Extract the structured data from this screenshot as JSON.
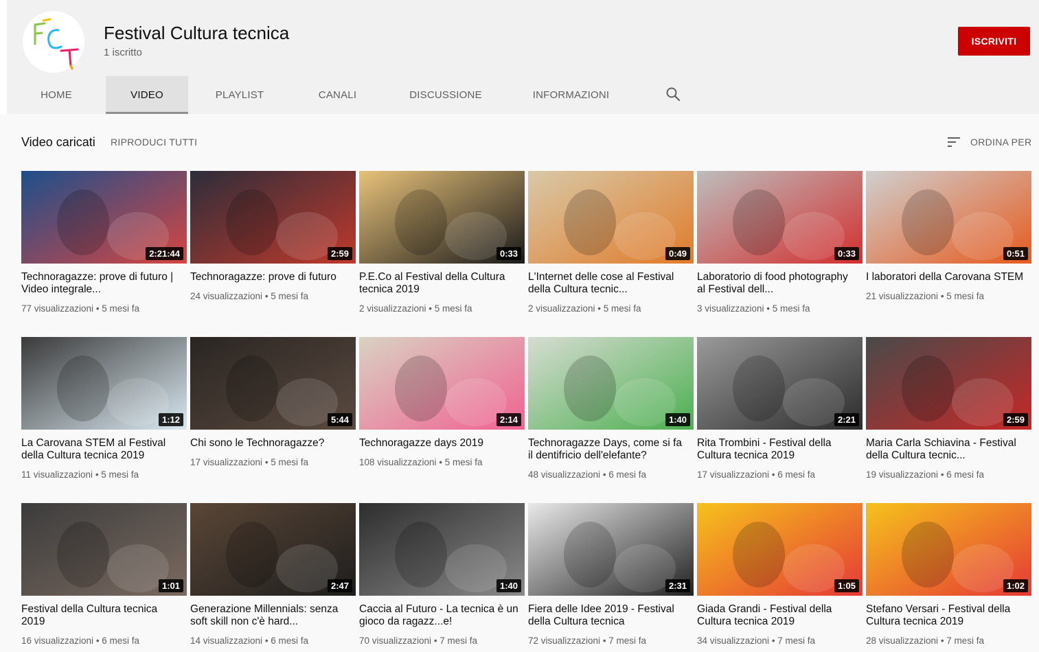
{
  "channel": {
    "name": "Festival Cultura tecnica",
    "subscribers": "1 iscritto",
    "subscribe_label": "ISCRIVITI",
    "logo_letters": "FCT"
  },
  "tabs": [
    {
      "label": "HOME",
      "active": false
    },
    {
      "label": "VIDEO",
      "active": true
    },
    {
      "label": "PLAYLIST",
      "active": false
    },
    {
      "label": "CANALI",
      "active": false
    },
    {
      "label": "DISCUSSIONE",
      "active": false
    },
    {
      "label": "INFORMAZIONI",
      "active": false
    }
  ],
  "section": {
    "title": "Video caricati",
    "play_all": "RIPRODUCI TUTTI",
    "sort_label": "ORDINA PER"
  },
  "colors": {
    "accent": "#cc0000",
    "header_bg": "#f1f1f1",
    "page_bg": "#f9f9f9",
    "text_secondary": "#606060"
  },
  "videos": [
    {
      "title": "Technoragazze: prove di futuro | Video integrale...",
      "views": "77 visualizzazioni",
      "age": "5 mesi fa",
      "duration": "2:21:44",
      "c1": "#1d4f8c",
      "c2": "#d64541"
    },
    {
      "title": "Technoragazze: prove di futuro",
      "views": "24 visualizzazioni",
      "age": "5 mesi fa",
      "duration": "2:59",
      "c1": "#2d2d3a",
      "c2": "#c0392b"
    },
    {
      "title": "P.E.Co al Festival della Cultura tecnica 2019",
      "views": "2 visualizzazioni",
      "age": "5 mesi fa",
      "duration": "0:33",
      "c1": "#e8c27a",
      "c2": "#1a1a1a"
    },
    {
      "title": "L'Internet delle cose al Festival della Cultura tecnic...",
      "views": "2 visualizzazioni",
      "age": "5 mesi fa",
      "duration": "0:49",
      "c1": "#d8c9a8",
      "c2": "#e07b2a"
    },
    {
      "title": "Laboratorio di food photography al Festival dell...",
      "views": "3 visualizzazioni",
      "age": "5 mesi fa",
      "duration": "0:33",
      "c1": "#bdbdbd",
      "c2": "#d32f2f"
    },
    {
      "title": "I laboratori della Carovana STEM",
      "views": "21 visualizzazioni",
      "age": "5 mesi fa",
      "duration": "0:51",
      "c1": "#cfcfcf",
      "c2": "#e65a1e"
    },
    {
      "title": "La Carovana STEM al Festival della Cultura tecnica 2019",
      "views": "11 visualizzazioni",
      "age": "5 mesi fa",
      "duration": "1:12",
      "c1": "#3a3a3a",
      "c2": "#d9e8f0"
    },
    {
      "title": "Chi sono le Technoragazze?",
      "views": "17 visualizzazioni",
      "age": "5 mesi fa",
      "duration": "5:44",
      "c1": "#2a2522",
      "c2": "#5a4a40"
    },
    {
      "title": "Technoragazze days 2019",
      "views": "108 visualizzazioni",
      "age": "5 mesi fa",
      "duration": "2:14",
      "c1": "#d9d2c2",
      "c2": "#f06292"
    },
    {
      "title": "Technoragazze Days, come si fa il dentifricio dell'elefante?",
      "views": "48 visualizzazioni",
      "age": "6 mesi fa",
      "duration": "1:40",
      "c1": "#d7dcd2",
      "c2": "#4caf50"
    },
    {
      "title": "Rita Trombini - Festival della Cultura tecnica 2019",
      "views": "17 visualizzazioni",
      "age": "6 mesi fa",
      "duration": "2:21",
      "c1": "#9a9a9a",
      "c2": "#2b2b2b"
    },
    {
      "title": "Maria Carla Schiavina - Festival della Cultura tecnic...",
      "views": "19 visualizzazioni",
      "age": "6 mesi fa",
      "duration": "2:59",
      "c1": "#4a4a4a",
      "c2": "#c62828"
    },
    {
      "title": "Festival della Cultura tecnica 2019",
      "views": "16 visualizzazioni",
      "age": "6 mesi fa",
      "duration": "1:01",
      "c1": "#3c3c3c",
      "c2": "#7a6a60"
    },
    {
      "title": "Generazione Millennials: senza soft skill non c'è hard...",
      "views": "14 visualizzazioni",
      "age": "6 mesi fa",
      "duration": "2:47",
      "c1": "#5a4636",
      "c2": "#1e1e1e"
    },
    {
      "title": "Caccia al Futuro - La tecnica è un gioco da ragazz...e!",
      "views": "70 visualizzazioni",
      "age": "7 mesi fa",
      "duration": "1:40",
      "c1": "#2e2e2e",
      "c2": "#8a8a8a"
    },
    {
      "title": "Fiera delle Idee 2019 - Festival della Cultura tecnica",
      "views": "72 visualizzazioni",
      "age": "7 mesi fa",
      "duration": "2:31",
      "c1": "#e9e9e9",
      "c2": "#222222"
    },
    {
      "title": "Giada Grandi - Festival della Cultura tecnica 2019",
      "views": "34 visualizzazioni",
      "age": "7 mesi fa",
      "duration": "1:05",
      "c1": "#f6c21c",
      "c2": "#e53935"
    },
    {
      "title": "Stefano Versari - Festival della Cultura tecnica 2019",
      "views": "28 visualizzazioni",
      "age": "7 mesi fa",
      "duration": "1:02",
      "c1": "#f6c21c",
      "c2": "#e53935"
    }
  ]
}
